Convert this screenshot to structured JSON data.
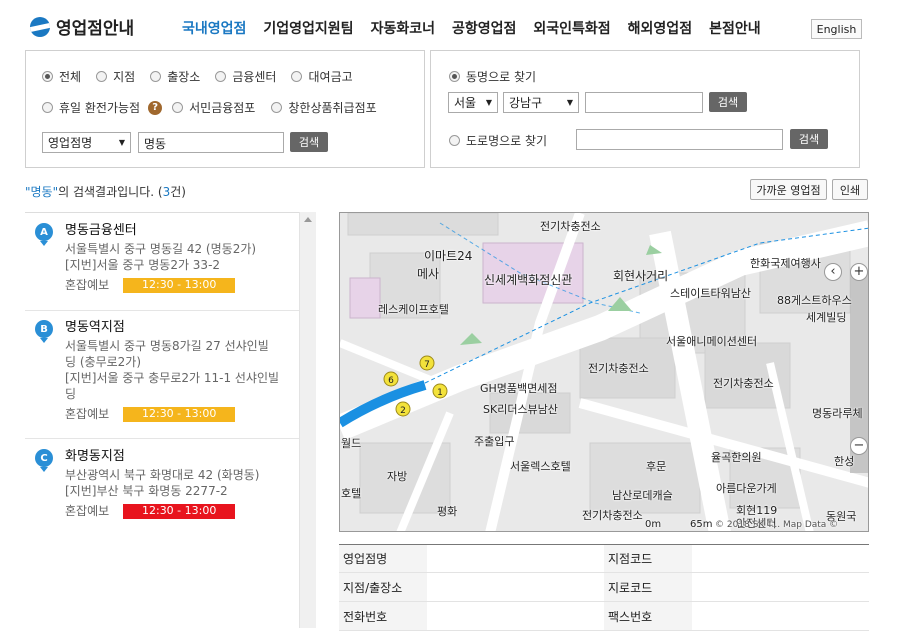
{
  "header": {
    "logo_text": "영업점안내",
    "nav": [
      "국내영업점",
      "기업영업지원팀",
      "자동화코너",
      "공항영업점",
      "외국인특화점",
      "해외영업점",
      "본점안내"
    ],
    "lang_button": "English"
  },
  "search_left": {
    "radios_row1": [
      "전체",
      "지점",
      "출장소",
      "금융센터",
      "대여금고"
    ],
    "radios_row2": [
      "휴일 환전가능점",
      "서민금융점포",
      "창한상품취급점포"
    ],
    "help_icon": "question-icon",
    "type_select": "영업점명",
    "keyword": "명동",
    "search_button": "검색"
  },
  "search_right": {
    "by_dong_label": "동명으로 찾기",
    "city_select": "서울",
    "district_select": "강남구",
    "dong_input": "",
    "search_button_1": "검색",
    "by_road_label": "도로명으로 찾기",
    "road_input": "",
    "search_button_2": "검색"
  },
  "results": {
    "quoted_keyword": "\"명동\"",
    "suffix": "의 검색결과입니다. (",
    "count": "3",
    "count_suffix": "건)",
    "nearest_button": "가까운 영업점",
    "print_button": "인쇄"
  },
  "branches": [
    {
      "marker": "A",
      "name": "명동금융센터",
      "address_lines": [
        "서울특별시 중구 명동길 42 (명동2가)",
        "[지번]서울 중구 명동2가 33-2"
      ],
      "congestion_label": "혼잡예보",
      "congestion_time": "12:30 - 13:00"
    },
    {
      "marker": "B",
      "name": "명동역지점",
      "address_lines": [
        "서울특별시 중구 명동8가길 27 선샤인빌",
        "딩 (충무로2가)",
        "[지번]서울 중구 충무로2가 11-1 선샤인빌",
        "딩"
      ],
      "congestion_label": "혼잡예보",
      "congestion_time": "12:30 - 13:00"
    },
    {
      "marker": "C",
      "name": "화명동지점",
      "address_lines": [
        "부산광역시 북구 화명대로 42 (화명동)",
        "[지번]부산 북구 화명동 2277-2"
      ],
      "congestion_label": "혼잡예보",
      "congestion_time": "12:30 - 13:00"
    }
  ],
  "map": {
    "labels": [
      "전기차충전소",
      "이마트24",
      "메사",
      "신세계백화점신관",
      "회현사거리",
      "한화국제여행사",
      "스테이트타워남산",
      "88게스트하우스",
      "세계빌딩",
      "레스케이프호텔",
      "서울애니메이션센터",
      "전기차충전소",
      "전기차충전소",
      "GH명품백면세점",
      "SK리더스뷰남산",
      "명동라루체",
      "주출입구",
      "서울렉스호텔",
      "후문",
      "율곡한의원",
      "한성",
      "월드",
      "자방",
      "호텔",
      "평화",
      "남산로데캐슬",
      "아름다운가게",
      "회현119",
      "안전센터",
      "동원국",
      "전기차충전소"
    ],
    "markers": [
      "1",
      "2",
      "6",
      "7"
    ],
    "scale_labels": [
      "0m",
      "65m"
    ],
    "footer_text": "© 2018 SK T... Map Data ©"
  },
  "info_table": {
    "rows": [
      [
        "영업점명",
        "",
        "지점코드",
        ""
      ],
      [
        "지점/출장소",
        "",
        "지로코드",
        ""
      ],
      [
        "전화번호",
        "",
        "팩스번호",
        ""
      ]
    ]
  }
}
